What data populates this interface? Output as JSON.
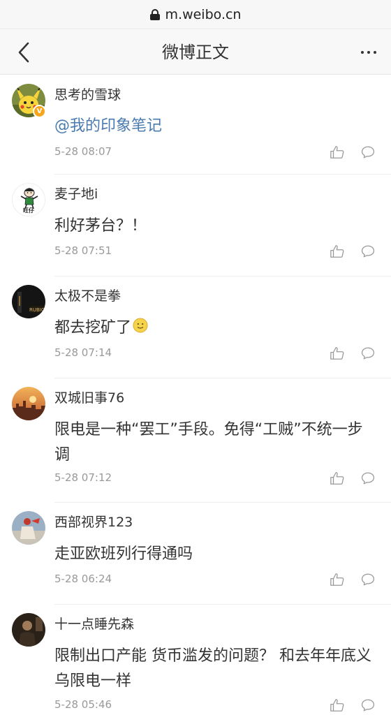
{
  "browser": {
    "url": "m.weibo.cn"
  },
  "header": {
    "title": "微博正文"
  },
  "comments": [
    {
      "username": "思考的雪球",
      "mention": "@我的印象笔记",
      "text": "",
      "time": "5-28 08:07",
      "verified": true
    },
    {
      "username": "麦子地i",
      "text": "利好茅台？！",
      "time": "5-28 07:51",
      "avatar_caption": "旺仔"
    },
    {
      "username": "太极不是拳",
      "text": "都去挖矿了",
      "time": "5-28 07:14",
      "avatar_caption": "RUBICO"
    },
    {
      "username": "双城旧事76",
      "text": "限电是一种“罢工”手段。免得“工贼”不统一步调",
      "time": "5-28 07:12"
    },
    {
      "username": "西部视界123",
      "text": "走亚欧班列行得通吗",
      "time": "5-28 06:24"
    },
    {
      "username": "十一点睡先森",
      "text": "限制出口产能 货币滥发的问题？ 和去年年底义乌限电一样",
      "time": "5-28 05:46"
    }
  ],
  "colors": {
    "mention": "#4a7bb0",
    "timestamp": "#999999",
    "verified_badge": "#f7a51c"
  }
}
